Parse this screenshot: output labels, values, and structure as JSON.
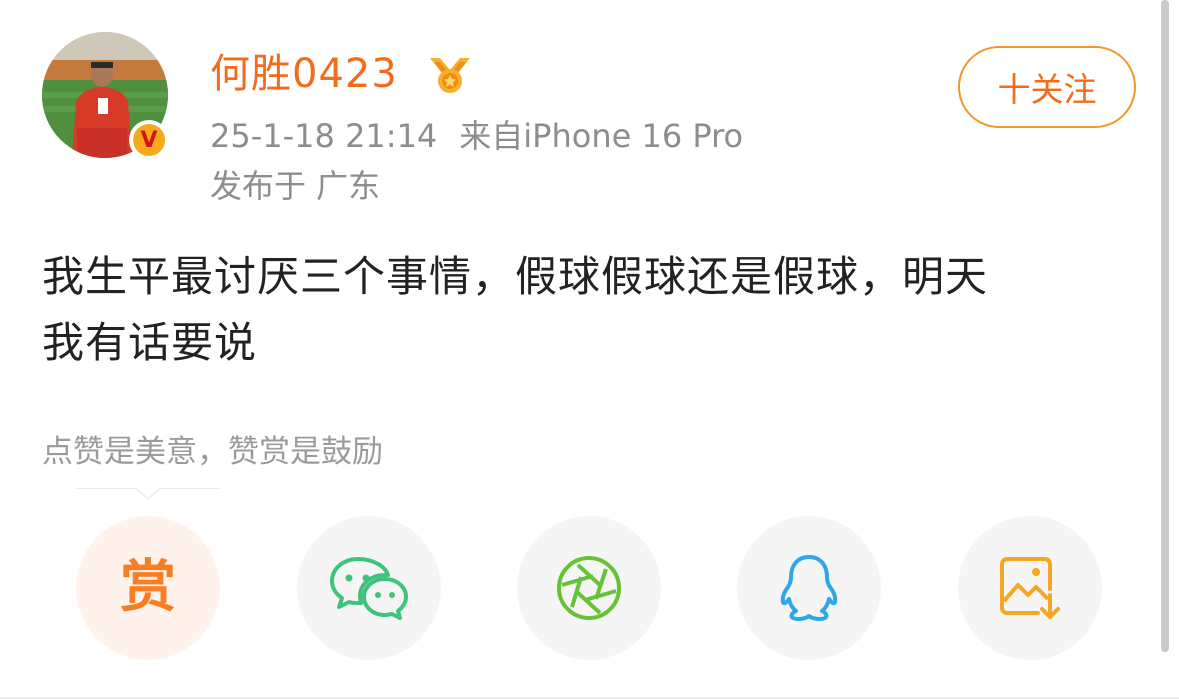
{
  "post": {
    "author": {
      "name": "何胜0423",
      "verified_mark": "V",
      "badge_icon": "medal-icon"
    },
    "timestamp": "25-1-18 21:14",
    "source": "来自iPhone 16 Pro",
    "location": "发布于 广东",
    "follow_label": "十关注",
    "content_line1": "我生平最讨厌三个事情，假球假球还是假球，明天",
    "content_line2": "我有话要说"
  },
  "reward": {
    "caption": "点赞是美意，赞赏是鼓励"
  },
  "share_bar": {
    "items": [
      {
        "name": "reward",
        "glyph": "赏",
        "color": "#f97d24"
      },
      {
        "name": "wechat",
        "icon": "wechat-icon",
        "color": "#3fc37c"
      },
      {
        "name": "moments",
        "icon": "moments-icon",
        "color": "#67c23a"
      },
      {
        "name": "qq",
        "icon": "qq-icon",
        "color": "#2ea6e8"
      },
      {
        "name": "save-image",
        "icon": "save-image-icon",
        "color": "#f5a623"
      }
    ]
  },
  "colors": {
    "accent": "#f26c1b",
    "meta_text": "#8d8d8d",
    "body_text": "#222222"
  }
}
